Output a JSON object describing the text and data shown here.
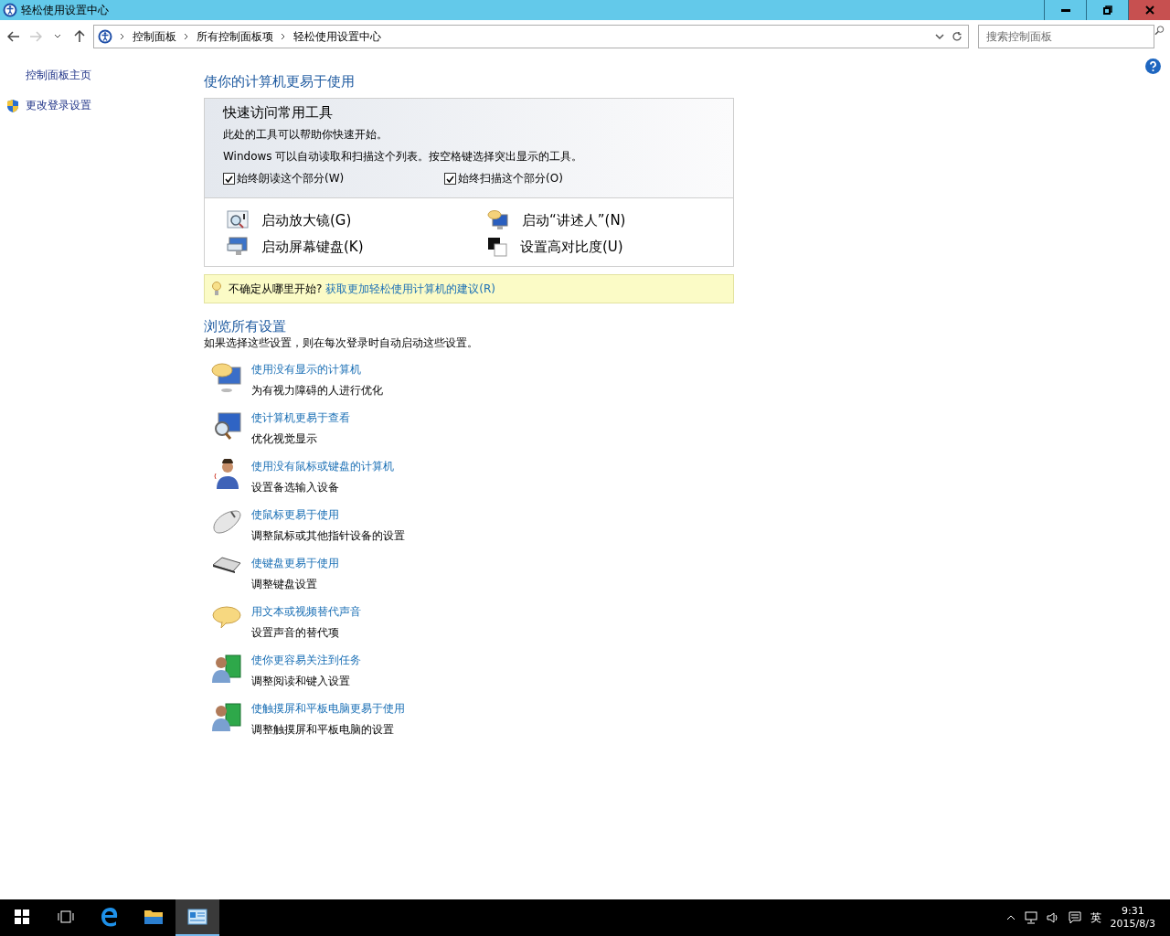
{
  "window": {
    "title": "轻松使用设置中心"
  },
  "address_bar": {
    "path": [
      "控制面板",
      "所有控制面板项",
      "轻松使用设置中心"
    ]
  },
  "search": {
    "placeholder": "搜索控制面板"
  },
  "sidebar": {
    "items": [
      {
        "label": "控制面板主页",
        "kind": "plain"
      },
      {
        "label": "更改登录设置",
        "kind": "shield"
      }
    ]
  },
  "heading": "使你的计算机更易于使用",
  "quick_access": {
    "title": "快速访问常用工具",
    "lines": [
      "此处的工具可以帮助你快速开始。",
      "Windows 可以自动读取和扫描这个列表。按空格键选择突出显示的工具。"
    ],
    "checkboxes": [
      {
        "label": "始终朗读这个部分(W)",
        "checked": true
      },
      {
        "label": "始终扫描这个部分(O)",
        "checked": true
      }
    ],
    "tools": [
      {
        "label": "启动放大镜(G)",
        "kind": "magnifier"
      },
      {
        "label": "启动“讲述人”(N)",
        "kind": "narrator"
      },
      {
        "label": "启动屏幕键盘(K)",
        "kind": "keyboard"
      },
      {
        "label": "设置高对比度(U)",
        "kind": "contrast"
      }
    ]
  },
  "tip": {
    "text": "不确定从哪里开始?",
    "link": "获取更加轻松使用计算机的建议(R)"
  },
  "browse": {
    "title": "浏览所有设置",
    "subtitle": "如果选择这些设置，则在每次登录时自动启动这些设置。",
    "items": [
      {
        "title": "使用没有显示的计算机",
        "description": "为有视力障碍的人进行优化",
        "kind": "monitor-speech"
      },
      {
        "title": "使计算机更易于查看",
        "description": "优化视觉显示",
        "kind": "monitor-magnifier"
      },
      {
        "title": "使用没有鼠标或键盘的计算机",
        "description": "设置备选输入设备",
        "kind": "person"
      },
      {
        "title": "使鼠标更易于使用",
        "description": "调整鼠标或其他指针设备的设置",
        "kind": "mouse"
      },
      {
        "title": "使键盘更易于使用",
        "description": "调整键盘设置",
        "kind": "keyboard"
      },
      {
        "title": "用文本或视频替代声音",
        "description": "设置声音的替代项",
        "kind": "speech"
      },
      {
        "title": "使你更容易关注到任务",
        "description": "调整阅读和键入设置",
        "kind": "person-book"
      },
      {
        "title": "使触摸屏和平板电脑更易于使用",
        "description": "调整触摸屏和平板电脑的设置",
        "kind": "person-book"
      }
    ]
  },
  "taskbar": {
    "apps": [
      {
        "kind": "task-view",
        "selected": false
      },
      {
        "kind": "browser",
        "selected": false
      },
      {
        "kind": "folder",
        "selected": false
      },
      {
        "kind": "control-panel",
        "selected": true
      }
    ],
    "tray": {
      "input_method": "英",
      "time": "9:31",
      "date": "2015/8/3"
    }
  }
}
